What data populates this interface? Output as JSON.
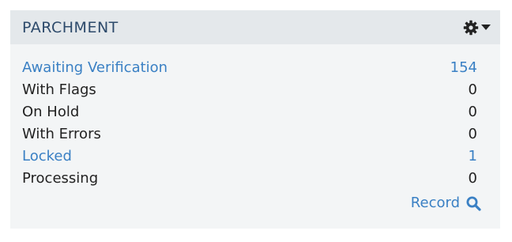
{
  "panel": {
    "title": "PARCHMENT",
    "settings_icon": "gear-icon",
    "dropdown_icon": "caret-down-icon",
    "rows": [
      {
        "label": "Awaiting Verification",
        "value": "154",
        "link": true
      },
      {
        "label": "With Flags",
        "value": "0",
        "link": false
      },
      {
        "label": "On Hold",
        "value": "0",
        "link": false
      },
      {
        "label": "With Errors",
        "value": "0",
        "link": false
      },
      {
        "label": "Locked",
        "value": "1",
        "link": true
      },
      {
        "label": "Processing",
        "value": "0",
        "link": false
      }
    ],
    "footer_link": "Record",
    "footer_icon": "search-icon"
  },
  "colors": {
    "link": "#3a80c4",
    "title": "#2d4a6b",
    "header_bg": "#e4e8eb",
    "panel_bg": "#f3f5f6"
  }
}
